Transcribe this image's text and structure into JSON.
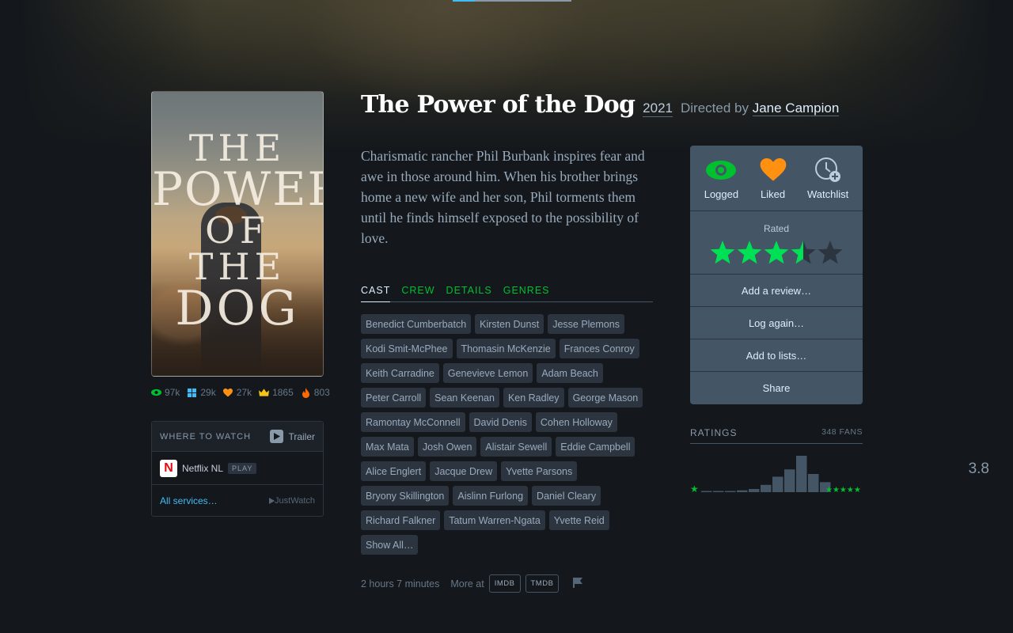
{
  "film": {
    "title": "The Power of the Dog",
    "year": "2021",
    "directed_by_label": "Directed by",
    "director": "Jane Campion",
    "synopsis": "Charismatic rancher Phil Burbank inspires fear and awe in those around him. When his brother brings home a new wife and her son, Phil torments them until he finds himself exposed to the possibility of love."
  },
  "poster": {
    "lines": [
      "THE",
      "POWER",
      "OF THE",
      "DOG"
    ]
  },
  "stats": [
    {
      "icon": "eye-icon",
      "value": "97k",
      "color": "#00c030"
    },
    {
      "icon": "grid-icon",
      "value": "29k",
      "color": "#40bcf4"
    },
    {
      "icon": "heart-icon",
      "value": "27k",
      "color": "#ff9010"
    },
    {
      "icon": "crown-icon",
      "value": "1865",
      "color": "#f5c518"
    },
    {
      "icon": "fire-icon",
      "value": "803",
      "color": "#ff6a00"
    }
  ],
  "where_to_watch": {
    "title": "WHERE TO WATCH",
    "trailer_label": "Trailer",
    "service": {
      "logo": "N",
      "name": "Netflix NL",
      "tag": "PLAY"
    },
    "all_services": "All services…",
    "provider": "JustWatch"
  },
  "tabs": [
    {
      "label": "CAST",
      "active": true
    },
    {
      "label": "CREW",
      "active": false
    },
    {
      "label": "DETAILS",
      "active": false
    },
    {
      "label": "GENRES",
      "active": false
    }
  ],
  "cast": [
    "Benedict Cumberbatch",
    "Kirsten Dunst",
    "Jesse Plemons",
    "Kodi Smit-McPhee",
    "Thomasin McKenzie",
    "Frances Conroy",
    "Keith Carradine",
    "Genevieve Lemon",
    "Adam Beach",
    "Peter Carroll",
    "Sean Keenan",
    "Ken Radley",
    "George Mason",
    "Ramontay McConnell",
    "David Denis",
    "Cohen Holloway",
    "Max Mata",
    "Josh Owen",
    "Alistair Sewell",
    "Eddie Campbell",
    "Alice Englert",
    "Jacque Drew",
    "Yvette Parsons",
    "Bryony Skillington",
    "Aislinn Furlong",
    "Daniel Cleary",
    "Richard Falkner",
    "Tatum Warren-Ngata",
    "Yvette Reid"
  ],
  "show_all": "Show All…",
  "meta": {
    "runtime": "2 hours 7 minutes",
    "more_at": "More at",
    "imdb": "IMDB",
    "tmdb": "TMDB"
  },
  "actions": {
    "logged": "Logged",
    "liked": "Liked",
    "watchlist": "Watchlist",
    "rated_label": "Rated",
    "user_rating": 3.5,
    "max_rating": 5,
    "add_review": "Add a review…",
    "log_again": "Log again…",
    "add_to_lists": "Add to lists…",
    "share": "Share"
  },
  "ratings": {
    "title": "RATINGS",
    "fans": "348 FANS",
    "average": "3.8",
    "histogram": [
      0.3,
      1,
      1,
      2,
      3.5,
      8,
      17,
      25,
      40,
      20,
      11
    ]
  },
  "colors": {
    "green": "#00c030",
    "orange": "#ff9010",
    "blue": "#40bcf4",
    "panel": "#445566"
  }
}
